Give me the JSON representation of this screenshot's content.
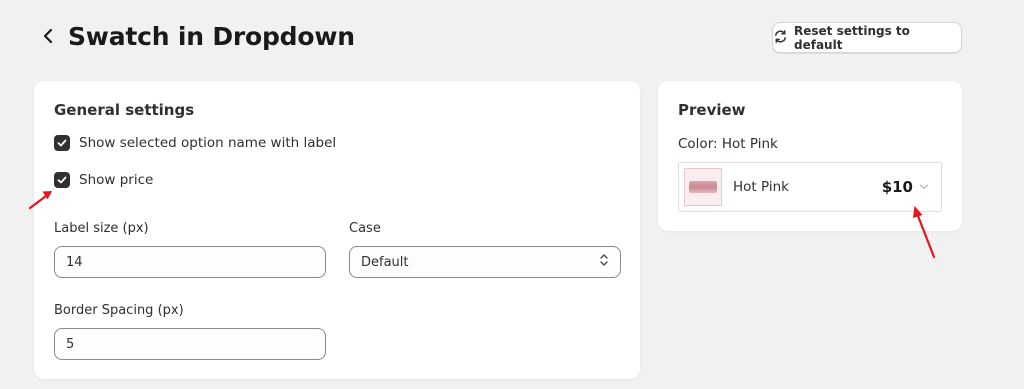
{
  "header": {
    "title": "Swatch in Dropdown",
    "reset_label": "Reset settings to default"
  },
  "general": {
    "title": "General settings",
    "show_selected_option_label": "Show selected option name with label",
    "show_selected_option_checked": true,
    "show_price_label": "Show price",
    "show_price_checked": true,
    "label_size_label": "Label size (px)",
    "label_size_value": "14",
    "case_label": "Case",
    "case_value": "Default",
    "border_spacing_label": "Border Spacing (px)",
    "border_spacing_value": "5"
  },
  "preview": {
    "title": "Preview",
    "color_label": "Color: Hot Pink",
    "option_name": "Hot Pink",
    "option_price": "$10"
  },
  "colors": {
    "annotation_arrow": "#e8141b",
    "checkbox": "#303030",
    "swatch": "#d9a7ad"
  },
  "icons": {
    "back": "chevron-left-icon",
    "reset": "refresh-icon",
    "checkbox": "checkmark-icon",
    "select": "select-updown-icon",
    "dropdown": "chevron-down-icon"
  }
}
